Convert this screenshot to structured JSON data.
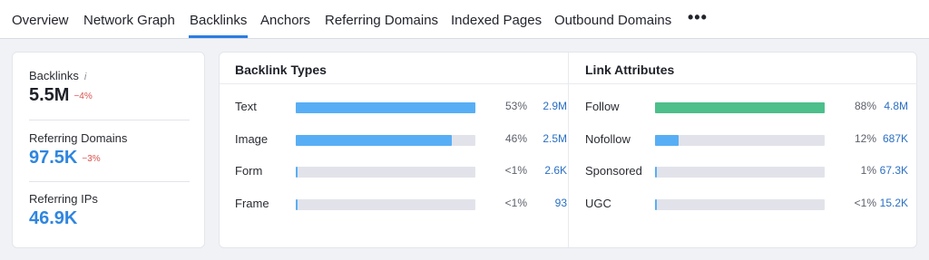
{
  "tabs": [
    {
      "label": "Overview",
      "active": false
    },
    {
      "label": "Network Graph",
      "active": false
    },
    {
      "label": "Backlinks",
      "active": true
    },
    {
      "label": "Anchors",
      "active": false
    },
    {
      "label": "Referring Domains",
      "active": false
    },
    {
      "label": "Indexed Pages",
      "active": false
    },
    {
      "label": "Outbound Domains",
      "active": false
    }
  ],
  "more_label": "•••",
  "summary": {
    "backlinks": {
      "label": "Backlinks",
      "value": "5.5M",
      "delta": "−4%",
      "info_icon": "i"
    },
    "referring_domains": {
      "label": "Referring Domains",
      "value": "97.5K",
      "delta": "−3%"
    },
    "referring_ips": {
      "label": "Referring IPs",
      "value": "46.9K"
    }
  },
  "backlink_types": {
    "title": "Backlink Types",
    "rows": [
      {
        "label": "Text",
        "fill": 1.0,
        "pct": "53%",
        "count": "2.9M"
      },
      {
        "label": "Image",
        "fill": 0.87,
        "pct": "46%",
        "count": "2.5M"
      },
      {
        "label": "Form",
        "fill": 0.01,
        "pct": "<1%",
        "count": "2.6K"
      },
      {
        "label": "Frame",
        "fill": 0.01,
        "pct": "<1%",
        "count": "93"
      }
    ]
  },
  "link_attributes": {
    "title": "Link Attributes",
    "rows": [
      {
        "label": "Follow",
        "fill": 1.0,
        "pct": "88%",
        "count": "4.8M"
      },
      {
        "label": "Nofollow",
        "fill": 0.14,
        "pct": "12%",
        "count": "687K"
      },
      {
        "label": "Sponsored",
        "fill": 0.01,
        "pct": "1%",
        "count": "67.3K"
      },
      {
        "label": "UGC",
        "fill": 0.01,
        "pct": "<1%",
        "count": "15.2K"
      }
    ]
  },
  "colors": {
    "accent": "#2a7de1",
    "blue_bar": "#58aef5",
    "green_bar": "#4cbf8b",
    "track": "#e2e3ea",
    "negative": "#d9534f"
  }
}
